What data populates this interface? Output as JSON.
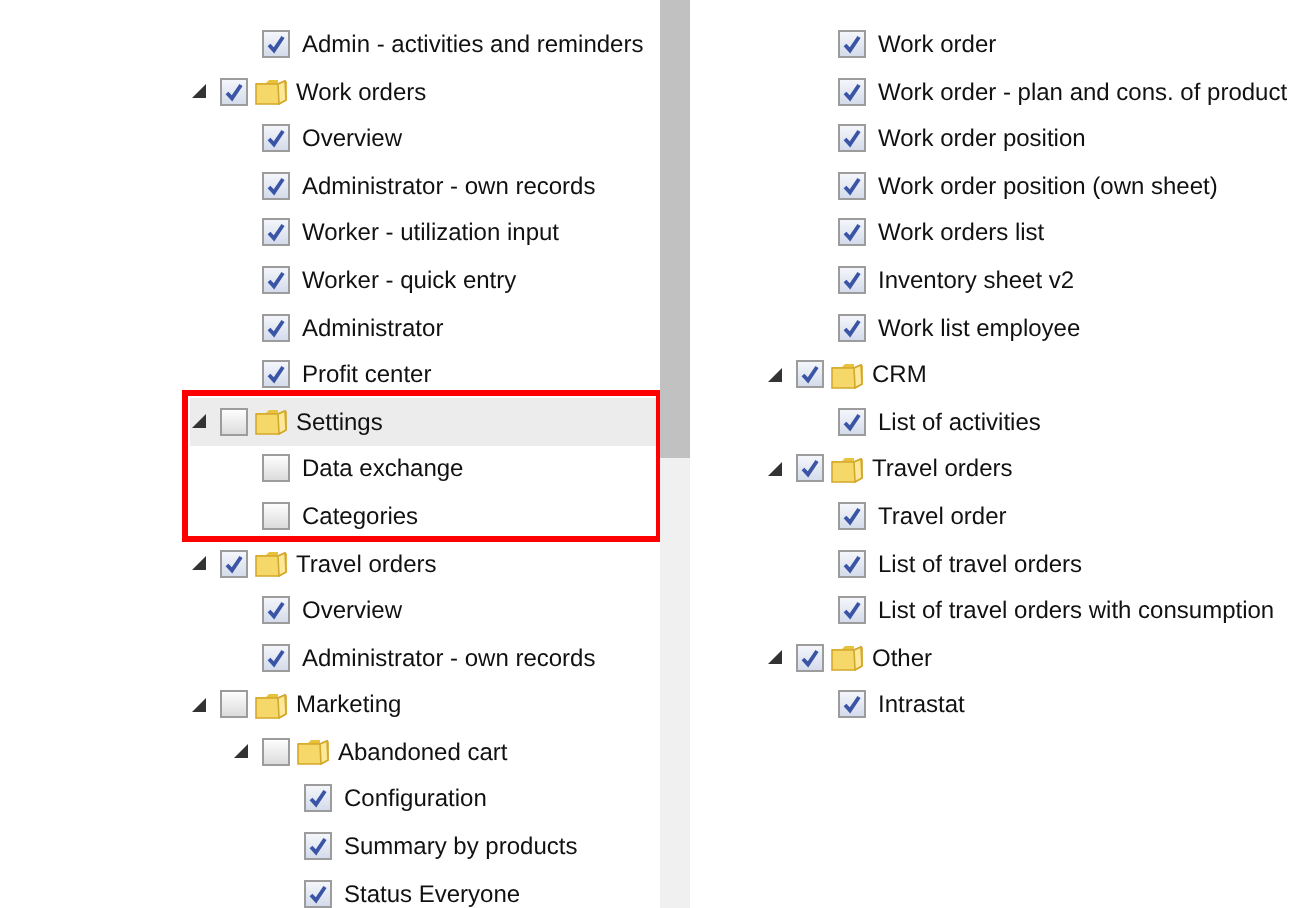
{
  "left_tree": {
    "items": [
      {
        "kind": "item",
        "label": "Admin - activities and reminders",
        "checked": true,
        "selected": false,
        "outlined": false
      },
      {
        "kind": "folder",
        "label": "Work orders",
        "checked": true,
        "selected": false,
        "outlined": false,
        "expanded": true,
        "children": [
          {
            "kind": "item",
            "label": "Overview",
            "checked": true,
            "selected": false,
            "outlined": false
          },
          {
            "kind": "item",
            "label": "Administrator - own records",
            "checked": true,
            "selected": false,
            "outlined": false
          },
          {
            "kind": "item",
            "label": "Worker - utilization input",
            "checked": true,
            "selected": false,
            "outlined": false
          },
          {
            "kind": "item",
            "label": "Worker - quick entry",
            "checked": true,
            "selected": false,
            "outlined": false
          },
          {
            "kind": "item",
            "label": "Administrator",
            "checked": true,
            "selected": false,
            "outlined": false
          },
          {
            "kind": "item",
            "label": "Profit center",
            "checked": true,
            "selected": false,
            "outlined": false
          }
        ]
      },
      {
        "kind": "folder",
        "label": "Settings",
        "checked": false,
        "selected": true,
        "outlined": true,
        "expanded": true,
        "children": [
          {
            "kind": "item",
            "label": "Data exchange",
            "checked": false,
            "selected": false,
            "outlined": false
          },
          {
            "kind": "item",
            "label": "Categories",
            "checked": false,
            "selected": false,
            "outlined": false
          }
        ]
      },
      {
        "kind": "folder",
        "label": "Travel orders",
        "checked": true,
        "selected": false,
        "outlined": false,
        "expanded": true,
        "children": [
          {
            "kind": "item",
            "label": "Overview",
            "checked": true,
            "selected": false,
            "outlined": false
          },
          {
            "kind": "item",
            "label": "Administrator - own records",
            "checked": true,
            "selected": false,
            "outlined": false
          }
        ]
      },
      {
        "kind": "folder",
        "label": "Marketing",
        "checked": false,
        "selected": false,
        "outlined": false,
        "expanded": true,
        "children": [
          {
            "kind": "folder",
            "label": "Abandoned cart",
            "checked": false,
            "selected": false,
            "outlined": false,
            "expanded": true,
            "children": [
              {
                "kind": "item",
                "label": "Configuration",
                "checked": true,
                "selected": false,
                "outlined": false
              },
              {
                "kind": "item",
                "label": "Summary by products",
                "checked": true,
                "selected": false,
                "outlined": false
              },
              {
                "kind": "item",
                "label": "Status Everyone",
                "checked": true,
                "selected": false,
                "outlined": false
              }
            ]
          }
        ]
      }
    ]
  },
  "right_tree": {
    "items": [
      {
        "kind": "item",
        "label": "Work order",
        "checked": true,
        "selected": false,
        "outlined": false
      },
      {
        "kind": "item",
        "label": "Work order - plan and cons. of product",
        "checked": true,
        "selected": false,
        "outlined": false
      },
      {
        "kind": "item",
        "label": "Work order position",
        "checked": true,
        "selected": false,
        "outlined": false
      },
      {
        "kind": "item",
        "label": "Work order position (own sheet)",
        "checked": true,
        "selected": false,
        "outlined": false
      },
      {
        "kind": "item",
        "label": "Work orders list",
        "checked": true,
        "selected": false,
        "outlined": false
      },
      {
        "kind": "item",
        "label": "Inventory sheet v2",
        "checked": true,
        "selected": false,
        "outlined": false
      },
      {
        "kind": "item",
        "label": "Work list employee",
        "checked": true,
        "selected": false,
        "outlined": false
      },
      {
        "kind": "folder",
        "label": "CRM",
        "checked": true,
        "selected": false,
        "outlined": false,
        "expanded": true,
        "children": [
          {
            "kind": "item",
            "label": "List of activities",
            "checked": true,
            "selected": false,
            "outlined": false
          }
        ]
      },
      {
        "kind": "folder",
        "label": "Travel orders",
        "checked": true,
        "selected": false,
        "outlined": false,
        "expanded": true,
        "children": [
          {
            "kind": "item",
            "label": "Travel order",
            "checked": true,
            "selected": false,
            "outlined": false
          },
          {
            "kind": "item",
            "label": "List of travel orders",
            "checked": true,
            "selected": false,
            "outlined": false
          },
          {
            "kind": "item",
            "label": "List of travel orders with consumption",
            "checked": true,
            "selected": false,
            "outlined": false
          }
        ]
      },
      {
        "kind": "folder",
        "label": "Other",
        "checked": true,
        "selected": false,
        "outlined": false,
        "expanded": true,
        "children": [
          {
            "kind": "item",
            "label": "Intrastat",
            "checked": true,
            "selected": false,
            "outlined": false
          }
        ]
      }
    ]
  }
}
